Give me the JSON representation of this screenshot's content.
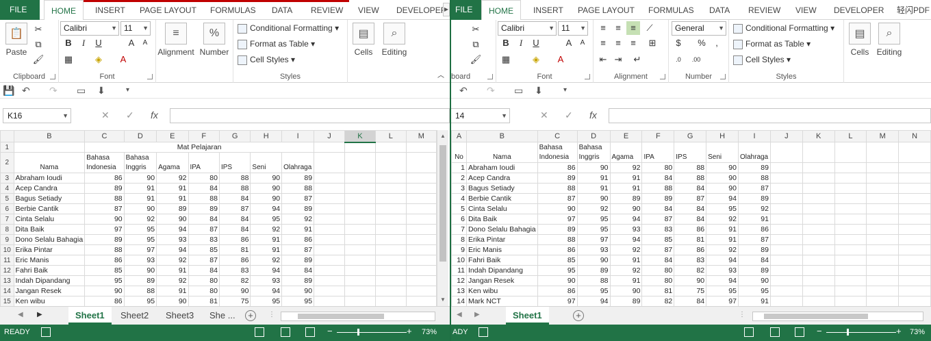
{
  "left": {
    "tabs": {
      "file": "FILE",
      "home": "HOME",
      "insert": "INSERT",
      "page_layout": "PAGE LAYOUT",
      "formulas": "FORMULAS",
      "data": "DATA",
      "review": "REVIEW",
      "view": "VIEW",
      "developer": "DEVELOPER"
    },
    "ribbon": {
      "paste": "Paste",
      "clipboard": "Clipboard",
      "font_name": "Calibri",
      "font_size": "11",
      "font": "Font",
      "alignment": "Alignment",
      "number": "Number",
      "cond_fmt": "Conditional Formatting",
      "fmt_table": "Format as Table",
      "cell_styles": "Cell Styles",
      "styles": "Styles",
      "cells": "Cells",
      "editing": "Editing"
    },
    "name_box": "K16",
    "columns": [
      "B",
      "C",
      "D",
      "E",
      "F",
      "G",
      "H",
      "I",
      "J",
      "K",
      "L",
      "M"
    ],
    "merged_header": "Mat Pelajaran",
    "header_row": [
      "Nama",
      "Bahasa Indonesia",
      "Bahasa Inggris",
      "Agama",
      "IPA",
      "IPS",
      "Seni",
      "Olahraga"
    ],
    "rows": [
      {
        "r": "3",
        "cells": [
          "Abraham Ioudi",
          "86",
          "90",
          "92",
          "80",
          "88",
          "90",
          "89"
        ]
      },
      {
        "r": "4",
        "cells": [
          "Acep Candra",
          "89",
          "91",
          "91",
          "84",
          "88",
          "90",
          "88"
        ]
      },
      {
        "r": "5",
        "cells": [
          "Bagus Setiady",
          "88",
          "91",
          "91",
          "88",
          "84",
          "90",
          "87"
        ]
      },
      {
        "r": "6",
        "cells": [
          "Berbie Cantik",
          "87",
          "90",
          "89",
          "89",
          "87",
          "94",
          "89"
        ]
      },
      {
        "r": "7",
        "cells": [
          "Cinta Selalu",
          "90",
          "92",
          "90",
          "84",
          "84",
          "95",
          "92"
        ]
      },
      {
        "r": "8",
        "cells": [
          "Dita Baik",
          "97",
          "95",
          "94",
          "87",
          "84",
          "92",
          "91"
        ]
      },
      {
        "r": "9",
        "cells": [
          "Dono Selalu Bahagia",
          "89",
          "95",
          "93",
          "83",
          "86",
          "91",
          "86"
        ]
      },
      {
        "r": "10",
        "cells": [
          "Erika Pintar",
          "88",
          "97",
          "94",
          "85",
          "81",
          "91",
          "87"
        ]
      },
      {
        "r": "11",
        "cells": [
          "Eric Manis",
          "86",
          "93",
          "92",
          "87",
          "86",
          "92",
          "89"
        ]
      },
      {
        "r": "12",
        "cells": [
          "Fahri Baik",
          "85",
          "90",
          "91",
          "84",
          "83",
          "94",
          "84"
        ]
      },
      {
        "r": "13",
        "cells": [
          "Indah Dipandang",
          "95",
          "89",
          "92",
          "80",
          "82",
          "93",
          "89"
        ]
      },
      {
        "r": "14",
        "cells": [
          "Jangan Resek",
          "90",
          "88",
          "91",
          "80",
          "90",
          "94",
          "90"
        ]
      },
      {
        "r": "15",
        "cells": [
          "Ken wibu",
          "86",
          "95",
          "90",
          "81",
          "75",
          "95",
          "95"
        ]
      }
    ],
    "sheets": [
      "Sheet1",
      "Sheet2",
      "Sheet3",
      "She ..."
    ],
    "status": "READY",
    "zoom": "73%"
  },
  "right": {
    "tabs": {
      "file": "FILE",
      "home": "HOME",
      "insert": "INSERT",
      "page_layout": "PAGE LAYOUT",
      "formulas": "FORMULAS",
      "data": "DATA",
      "review": "REVIEW",
      "view": "VIEW",
      "developer": "DEVELOPER",
      "pdf": "轻闪PDF"
    },
    "ribbon": {
      "clipboard": "board",
      "font_name": "Calibri",
      "font_size": "11",
      "font": "Font",
      "alignment": "Alignment",
      "number_format": "General",
      "number": "Number",
      "cond_fmt": "Conditional Formatting",
      "fmt_table": "Format as Table",
      "cell_styles": "Cell Styles",
      "styles": "Styles",
      "cells": "Cells",
      "editing": "Editing"
    },
    "name_box": "14",
    "columns": [
      "A",
      "B",
      "C",
      "D",
      "E",
      "F",
      "G",
      "H",
      "I",
      "J",
      "K",
      "L",
      "M",
      "N"
    ],
    "header_row": [
      "No",
      "Nama",
      "Bahasa Indonesia",
      "Bahasa Inggris",
      "Agama",
      "IPA",
      "IPS",
      "Seni",
      "Olahraga"
    ],
    "rows": [
      {
        "no": "1",
        "cells": [
          "Abraham Ioudi",
          "86",
          "90",
          "92",
          "80",
          "88",
          "90",
          "89"
        ]
      },
      {
        "no": "2",
        "cells": [
          "Acep Candra",
          "89",
          "91",
          "91",
          "84",
          "88",
          "90",
          "88"
        ]
      },
      {
        "no": "3",
        "cells": [
          "Bagus Setiady",
          "88",
          "91",
          "91",
          "88",
          "84",
          "90",
          "87"
        ]
      },
      {
        "no": "4",
        "cells": [
          "Berbie Cantik",
          "87",
          "90",
          "89",
          "89",
          "87",
          "94",
          "89"
        ]
      },
      {
        "no": "5",
        "cells": [
          "Cinta Selalu",
          "90",
          "92",
          "90",
          "84",
          "84",
          "95",
          "92"
        ]
      },
      {
        "no": "6",
        "cells": [
          "Dita Baik",
          "97",
          "95",
          "94",
          "87",
          "84",
          "92",
          "91"
        ]
      },
      {
        "no": "7",
        "cells": [
          "Dono Selalu Bahagia",
          "89",
          "95",
          "93",
          "83",
          "86",
          "91",
          "86"
        ]
      },
      {
        "no": "8",
        "cells": [
          "Erika Pintar",
          "88",
          "97",
          "94",
          "85",
          "81",
          "91",
          "87"
        ]
      },
      {
        "no": "9",
        "cells": [
          "Eric Manis",
          "86",
          "93",
          "92",
          "87",
          "86",
          "92",
          "89"
        ]
      },
      {
        "no": "10",
        "cells": [
          "Fahri Baik",
          "85",
          "90",
          "91",
          "84",
          "83",
          "94",
          "84"
        ]
      },
      {
        "no": "11",
        "cells": [
          "Indah Dipandang",
          "95",
          "89",
          "92",
          "80",
          "82",
          "93",
          "89"
        ]
      },
      {
        "no": "12",
        "cells": [
          "Jangan Resek",
          "90",
          "88",
          "91",
          "80",
          "90",
          "94",
          "90"
        ]
      },
      {
        "no": "13",
        "cells": [
          "Ken wibu",
          "86",
          "95",
          "90",
          "81",
          "75",
          "95",
          "95"
        ]
      },
      {
        "no": "14",
        "cells": [
          "Mark NCT",
          "97",
          "94",
          "89",
          "82",
          "84",
          "97",
          "91"
        ]
      }
    ],
    "sheets": [
      "Sheet1"
    ],
    "status": "ADY",
    "zoom": "73%"
  },
  "colors": {
    "accent": "#217346",
    "selection_line": "#c00000"
  }
}
